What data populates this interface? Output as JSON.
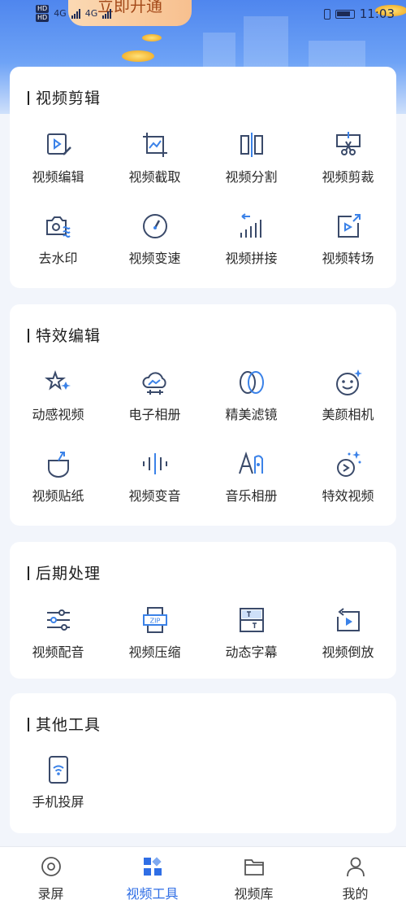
{
  "status_bar": {
    "hd1": "HD",
    "hd2": "HD",
    "net1": "4G",
    "net2": "4G",
    "time": "11:03"
  },
  "promo": {
    "text": "立即开通"
  },
  "colors": {
    "accent": "#2f6ee5",
    "icon": "#3a4a6a",
    "icon_accent": "#3b82e8"
  },
  "sections": [
    {
      "title": "视频剪辑",
      "items": [
        {
          "label": "视频编辑",
          "icon": "edit-video-icon"
        },
        {
          "label": "视频截取",
          "icon": "crop-frame-icon"
        },
        {
          "label": "视频分割",
          "icon": "split-icon"
        },
        {
          "label": "视频剪裁",
          "icon": "scissors-icon"
        },
        {
          "label": "去水印",
          "icon": "camera-wave-icon"
        },
        {
          "label": "视频变速",
          "icon": "speedometer-icon"
        },
        {
          "label": "视频拼接",
          "icon": "splice-bars-icon"
        },
        {
          "label": "视频转场",
          "icon": "transition-icon"
        }
      ]
    },
    {
      "title": "特效编辑",
      "items": [
        {
          "label": "动感视频",
          "icon": "sparkle-stars-icon"
        },
        {
          "label": "电子相册",
          "icon": "cloud-album-icon"
        },
        {
          "label": "精美滤镜",
          "icon": "filter-rings-icon"
        },
        {
          "label": "美颜相机",
          "icon": "smile-face-icon"
        },
        {
          "label": "视频贴纸",
          "icon": "sticker-icon"
        },
        {
          "label": "视频变音",
          "icon": "sound-wave-icon"
        },
        {
          "label": "音乐相册",
          "icon": "music-album-icon"
        },
        {
          "label": "特效视频",
          "icon": "effect-video-icon"
        }
      ]
    },
    {
      "title": "后期处理",
      "items": [
        {
          "label": "视频配音",
          "icon": "sliders-icon"
        },
        {
          "label": "视频压缩",
          "icon": "zip-icon"
        },
        {
          "label": "动态字幕",
          "icon": "subtitle-icon"
        },
        {
          "label": "视频倒放",
          "icon": "rewind-play-icon"
        }
      ]
    },
    {
      "title": "其他工具",
      "items": [
        {
          "label": "手机投屏",
          "icon": "screen-cast-icon"
        }
      ]
    }
  ],
  "tabbar": [
    {
      "label": "录屏",
      "icon": "record-icon",
      "active": false
    },
    {
      "label": "视频工具",
      "icon": "tools-grid-icon",
      "active": true
    },
    {
      "label": "视频库",
      "icon": "folder-icon",
      "active": false
    },
    {
      "label": "我的",
      "icon": "person-icon",
      "active": false
    }
  ]
}
